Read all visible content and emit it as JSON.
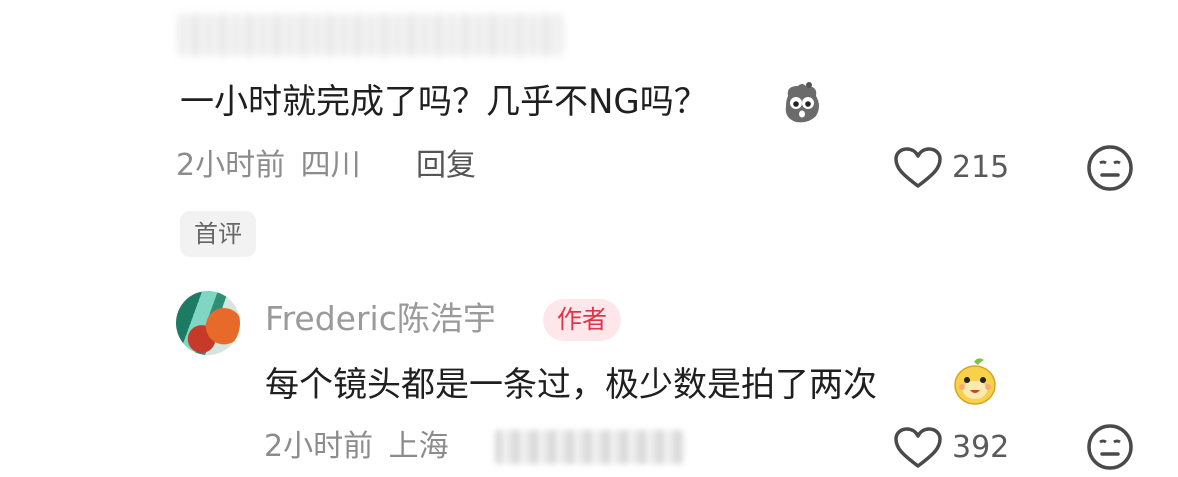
{
  "comment": {
    "text": "一小时就完成了吗？几乎不NG吗？",
    "time": "2小时前",
    "location": "四川",
    "reply_label": "回复",
    "likes": "215",
    "badge": "首评"
  },
  "reply": {
    "author": "Frederic陈浩宇",
    "author_tag": "作者",
    "text": "每个镜头都是一条过，极少数是拍了两次",
    "time": "2小时前",
    "location": "上海",
    "likes": "392"
  },
  "icons": {
    "emoji_1": "surprised-emoji-icon",
    "emoji_2": "happy-emoji-icon",
    "like": "heart-outline-icon",
    "dislike": "neutral-face-icon"
  },
  "colors": {
    "text": "#1f1f1f",
    "meta": "#8c8c8c",
    "author_tag_bg": "#fde7ea",
    "author_tag_text": "#e0344b"
  }
}
